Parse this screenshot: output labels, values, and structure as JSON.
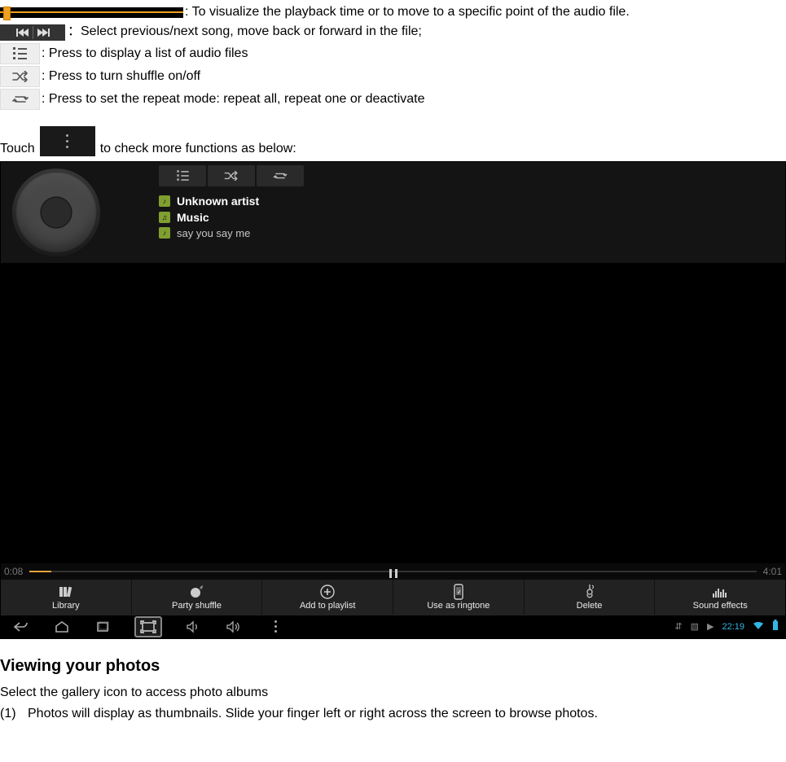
{
  "lines": {
    "seek": ": To visualize the playback time or to move to a specific point of the audio file.",
    "prevnext": "：Select previous/next song, move back or forward in the file;",
    "list": ": Press to display a list of audio files",
    "shuffle": ": Press to turn shuffle on/off",
    "repeat": ": Press to set the repeat mode: repeat all, repeat one or deactivate"
  },
  "touch": {
    "before": "Touch",
    "after": " to check more functions as below:"
  },
  "player": {
    "artist": "Unknown artist",
    "album": "Music",
    "track": "say you say me",
    "time_left": "0:08",
    "time_right": "4:01"
  },
  "menu": {
    "library": "Library",
    "party": "Party shuffle",
    "addpl": "Add to playlist",
    "ringtone": "Use as ringtone",
    "delete": "Delete",
    "effects": "Sound effects"
  },
  "status": {
    "clock": "22:19"
  },
  "section": {
    "heading": "Viewing your photos",
    "intro": "Select the gallery icon to access photo albums",
    "item1_num": "(1)",
    "item1_text": "Photos will display as thumbnails. Slide your finger left or right across the screen to browse photos."
  }
}
